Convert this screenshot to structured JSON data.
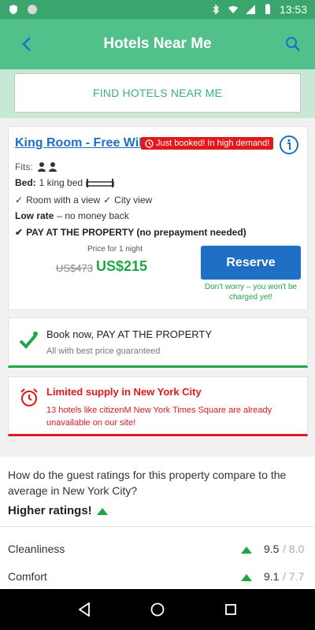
{
  "status_bar": {
    "time": "13:53"
  },
  "app_bar": {
    "title": "Hotels Near Me"
  },
  "find_button": {
    "label": "FIND HOTELS NEAR ME"
  },
  "room": {
    "title": "King Room - Free WiFi",
    "badge": "Just booked! In high demand!",
    "fits_label": "Fits:",
    "bed_label": "Bed:",
    "bed_value": "1 king bed",
    "features": [
      "Room with a view",
      "City view"
    ],
    "low_rate_label": "Low rate",
    "low_rate_value": "– no money back",
    "pay_property": "PAY AT THE PROPERTY (no prepayment needed)",
    "price_label": "Price for 1 night",
    "old_price": "US$473",
    "new_price": "US$215",
    "reserve_label": "Reserve",
    "reserve_note": "Don't worry – you won't be charged yet!"
  },
  "book_card": {
    "title": "Book now, PAY AT THE PROPERTY",
    "subtitle": "All with best price guaranteed"
  },
  "limited_card": {
    "title": "Limited supply in New York City",
    "text": "13 hotels like citizenM New York Times Square are already unavailable on our site!"
  },
  "ratings": {
    "question": "How do the guest ratings for this property compare to the average in New York City?",
    "summary": "Higher ratings!",
    "metrics": [
      {
        "name": "Cleanliness",
        "score": "9.5",
        "avg": "/ 8.0"
      },
      {
        "name": "Comfort",
        "score": "9.1",
        "avg": "/ 7.7"
      }
    ]
  },
  "colors": {
    "primary_green": "#52c08a",
    "accent_blue": "#1f6fc4",
    "alert_red": "#e2181a",
    "price_green": "#1ea845"
  }
}
